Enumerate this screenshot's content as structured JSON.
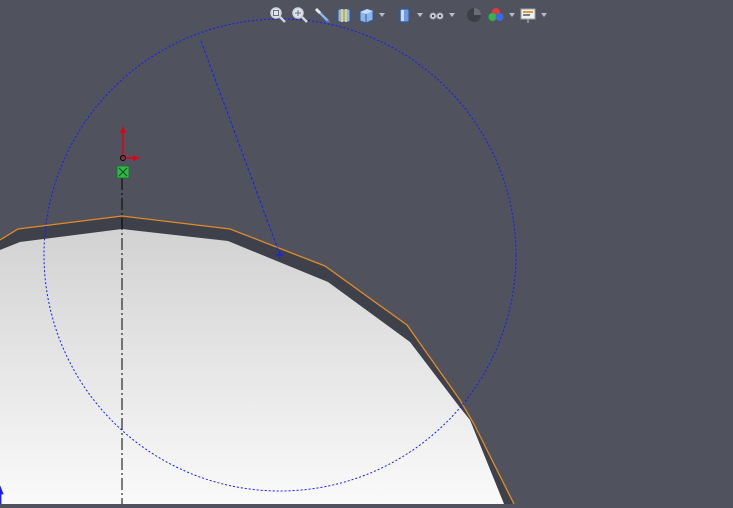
{
  "viewport": {
    "background": "#50535d",
    "part_fill_top": "#d2d2d2",
    "part_fill_bottom": "#fafafa",
    "outline_color": "#e08a2a",
    "sketch_color": "#1a1aff",
    "centerline_color": "#000000"
  },
  "toolbar": {
    "buttons": [
      {
        "name": "zoom-to-fit-button",
        "icon": "zoom-fit-icon"
      },
      {
        "name": "zoom-to-area-button",
        "icon": "zoom-area-icon"
      },
      {
        "name": "previous-view-button",
        "icon": "previous-view-icon"
      },
      {
        "name": "section-view-button",
        "icon": "section-view-icon"
      },
      {
        "name": "view-orientation-button",
        "icon": "view-orientation-icon"
      },
      {
        "name": "display-style-button",
        "icon": "display-style-icon"
      },
      {
        "name": "hide-show-items-button",
        "icon": "hide-show-icon"
      },
      {
        "name": "edit-appearance-button",
        "icon": "appearance-icon"
      },
      {
        "name": "apply-scene-button",
        "icon": "scene-icon"
      },
      {
        "name": "view-settings-button",
        "icon": "view-settings-icon"
      }
    ]
  }
}
